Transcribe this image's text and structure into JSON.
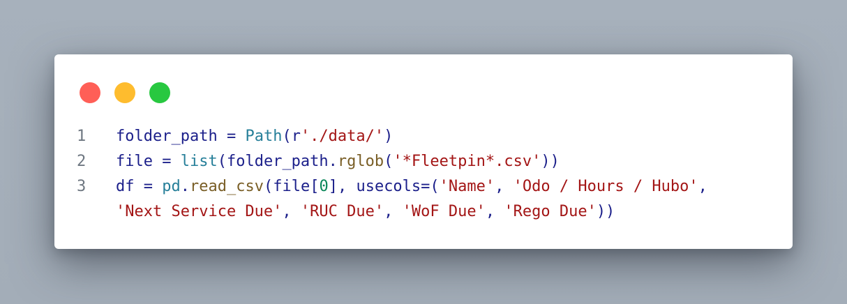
{
  "window": {
    "controls": {
      "close_color": "#ff5f57",
      "minimize_color": "#febc2e",
      "maximize_color": "#28c840"
    }
  },
  "code": {
    "lines": [
      {
        "number": "1",
        "tokens": [
          {
            "t": "folder_path",
            "k": "var"
          },
          {
            "t": " = ",
            "k": "op"
          },
          {
            "t": "Path",
            "k": "cls"
          },
          {
            "t": "(",
            "k": "punc"
          },
          {
            "t": "r",
            "k": "var"
          },
          {
            "t": "'./data/'",
            "k": "str"
          },
          {
            "t": ")",
            "k": "punc"
          }
        ]
      },
      {
        "number": "2",
        "tokens": [
          {
            "t": "file",
            "k": "var"
          },
          {
            "t": " = ",
            "k": "op"
          },
          {
            "t": "list",
            "k": "cls"
          },
          {
            "t": "(",
            "k": "punc"
          },
          {
            "t": "folder_path",
            "k": "var"
          },
          {
            "t": ".",
            "k": "punc"
          },
          {
            "t": "rglob",
            "k": "meth"
          },
          {
            "t": "(",
            "k": "punc"
          },
          {
            "t": "'*Fleetpin*.csv'",
            "k": "str"
          },
          {
            "t": "))",
            "k": "punc"
          }
        ]
      },
      {
        "number": "3",
        "tokens": [
          {
            "t": "df",
            "k": "var"
          },
          {
            "t": " = ",
            "k": "op"
          },
          {
            "t": "pd",
            "k": "cls"
          },
          {
            "t": ".",
            "k": "punc"
          },
          {
            "t": "read_csv",
            "k": "meth"
          },
          {
            "t": "(",
            "k": "punc"
          },
          {
            "t": "file",
            "k": "var"
          },
          {
            "t": "[",
            "k": "punc"
          },
          {
            "t": "0",
            "k": "num"
          },
          {
            "t": "], ",
            "k": "punc"
          },
          {
            "t": "usecols",
            "k": "var"
          },
          {
            "t": "=(",
            "k": "punc"
          },
          {
            "t": "'Name'",
            "k": "str"
          },
          {
            "t": ", ",
            "k": "punc"
          },
          {
            "t": "'Odo / Hours / Hubo'",
            "k": "str"
          },
          {
            "t": ",",
            "k": "punc"
          }
        ]
      },
      {
        "number": "",
        "tokens": [
          {
            "t": "'Next Service Due'",
            "k": "str"
          },
          {
            "t": ", ",
            "k": "punc"
          },
          {
            "t": "'RUC Due'",
            "k": "str"
          },
          {
            "t": ", ",
            "k": "punc"
          },
          {
            "t": "'WoF Due'",
            "k": "str"
          },
          {
            "t": ", ",
            "k": "punc"
          },
          {
            "t": "'Rego Due'",
            "k": "str"
          },
          {
            "t": "))",
            "k": "punc"
          }
        ]
      }
    ]
  }
}
